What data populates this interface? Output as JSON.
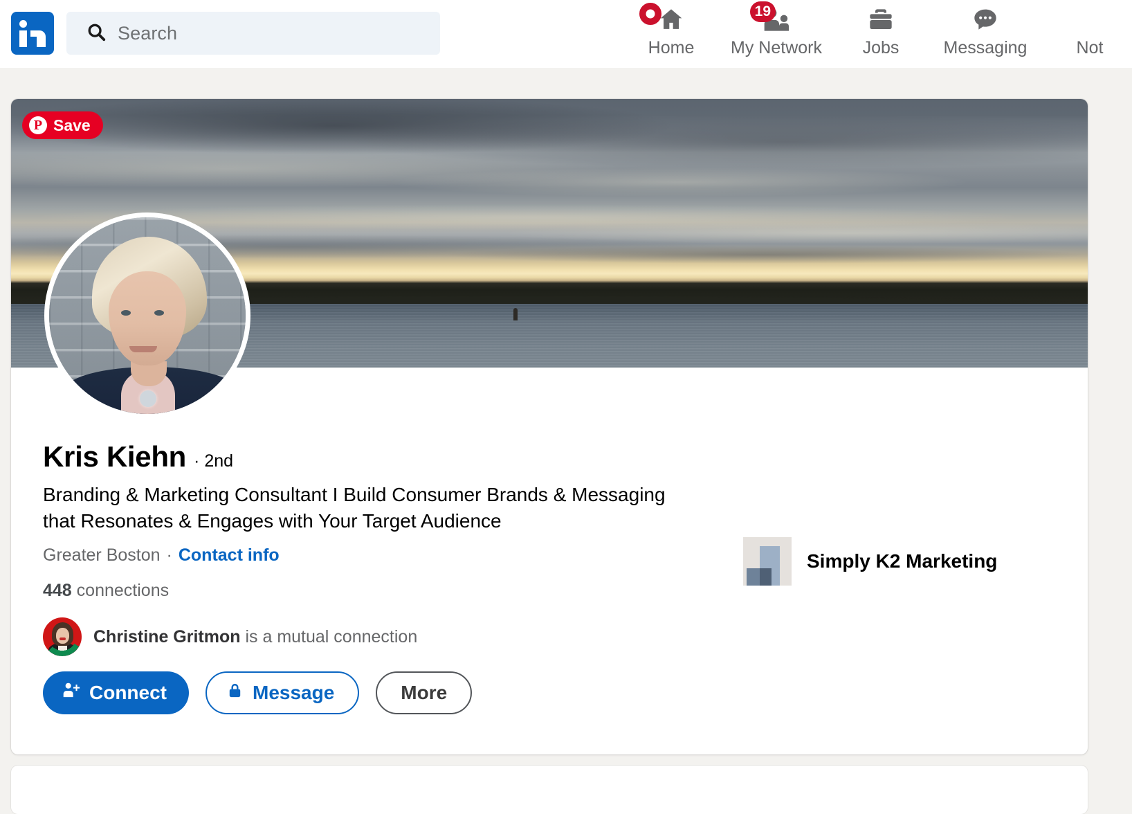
{
  "nav": {
    "logo_icon": "linkedin-logo",
    "search": {
      "icon": "search-icon",
      "placeholder": "Search",
      "value": ""
    },
    "items": [
      {
        "label": "Home",
        "icon": "home-icon",
        "badge": "",
        "badge_type": "dot"
      },
      {
        "label": "My Network",
        "icon": "network-icon",
        "badge": "19",
        "badge_type": "count"
      },
      {
        "label": "Jobs",
        "icon": "briefcase-icon",
        "badge": "",
        "badge_type": "none"
      },
      {
        "label": "Messaging",
        "icon": "message-icon",
        "badge": "",
        "badge_type": "none"
      },
      {
        "label": "Not",
        "icon": "bell-icon",
        "badge": "",
        "badge_type": "none"
      }
    ]
  },
  "banner": {
    "alt": "sunset-over-water-banner",
    "pinterest_save": {
      "icon": "pinterest-icon",
      "label": "Save"
    }
  },
  "profile": {
    "avatar_alt": "profile-photo-kris-kiehn",
    "name": "Kris Kiehn",
    "degree": "· 2nd",
    "headline": "Branding & Marketing Consultant I Build Consumer Brands & Messaging that Resonates & Engages with Your Target Audience",
    "location": "Greater Boston",
    "location_separator": "·",
    "contact_info_label": "Contact info",
    "connections_count": "448",
    "connections_label": "connections",
    "mutual": {
      "avatar_alt": "mutual-connection-avatar-christine-gritmon",
      "name": "Christine Gritmon",
      "suffix": "is a mutual connection"
    },
    "actions": [
      {
        "label": "Connect",
        "icon": "person-add-icon",
        "style": "primary"
      },
      {
        "label": "Message",
        "icon": "lock-icon",
        "style": "outline-blue"
      },
      {
        "label": "More",
        "icon": "",
        "style": "outline-dark"
      }
    ],
    "company": {
      "logo_alt": "simply-k2-marketing-logo",
      "name": "Simply K2 Marketing"
    }
  },
  "colors": {
    "linkedin_blue": "#0a66c2",
    "badge_red": "#cb112d",
    "pinterest_red": "#e60023",
    "page_background": "#f3f2ef",
    "text_muted": "#666769"
  }
}
